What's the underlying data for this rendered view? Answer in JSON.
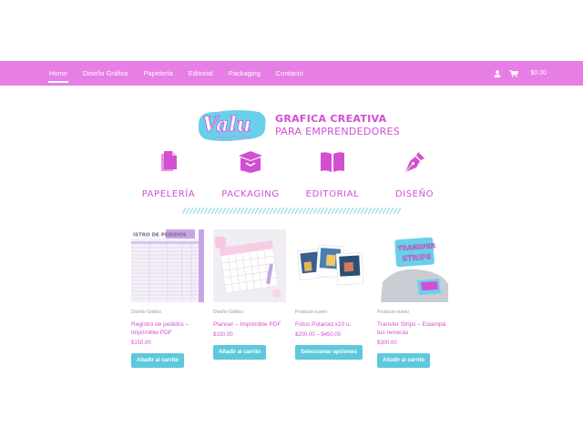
{
  "nav": {
    "links": [
      "Home",
      "Diseño Gráfico",
      "Papelería",
      "Editorial",
      "Packaging",
      "Contacto"
    ],
    "active_index": 0,
    "cart_total": "$0.00",
    "icons": [
      "user-icon",
      "cart-icon"
    ]
  },
  "brand": {
    "logo_text": "Valu",
    "logo_sub": "gráfica creativa",
    "tagline_line1": "GRAFICA CREATIVA",
    "tagline_line2": "PARA EMPRENDEDORES"
  },
  "categories": [
    {
      "label": "PAPELERÍA",
      "icon": "file-icon"
    },
    {
      "label": "PACKAGING",
      "icon": "box-icon"
    },
    {
      "label": "EDITORIAL",
      "icon": "book-icon"
    },
    {
      "label": "DISEÑO",
      "icon": "pen-nib-icon"
    }
  ],
  "products": [
    {
      "category": "Diseño Gráfico",
      "name": "Registro de pedidos – Imprimible PDF",
      "price": "$150.00",
      "button": "Añadir al carrito",
      "thumb_text": "ISTRO DE PEDIDOS"
    },
    {
      "category": "Diseño Gráfico",
      "name": "Planner – Imprimible PDF",
      "price": "$150.00",
      "button": "Añadir al carrito"
    },
    {
      "category": "Producto nuevo",
      "name": "Fotos Polaroid x10 u.",
      "price": "$200.00 – $450.00",
      "button": "Seleccionar opciones"
    },
    {
      "category": "Producto nuevo",
      "name": "Transfer Strips – Estampá tus remeras",
      "price": "$300.00",
      "button": "Añadir al carrito",
      "thumb_text_1": "TRANSFER",
      "thumb_text_2": "STRIPS"
    }
  ],
  "colors": {
    "nav_bg": "#e67ee6",
    "accent": "#d24fd2",
    "button": "#5ec8dd",
    "logo_blue": "#6ad0ea"
  }
}
